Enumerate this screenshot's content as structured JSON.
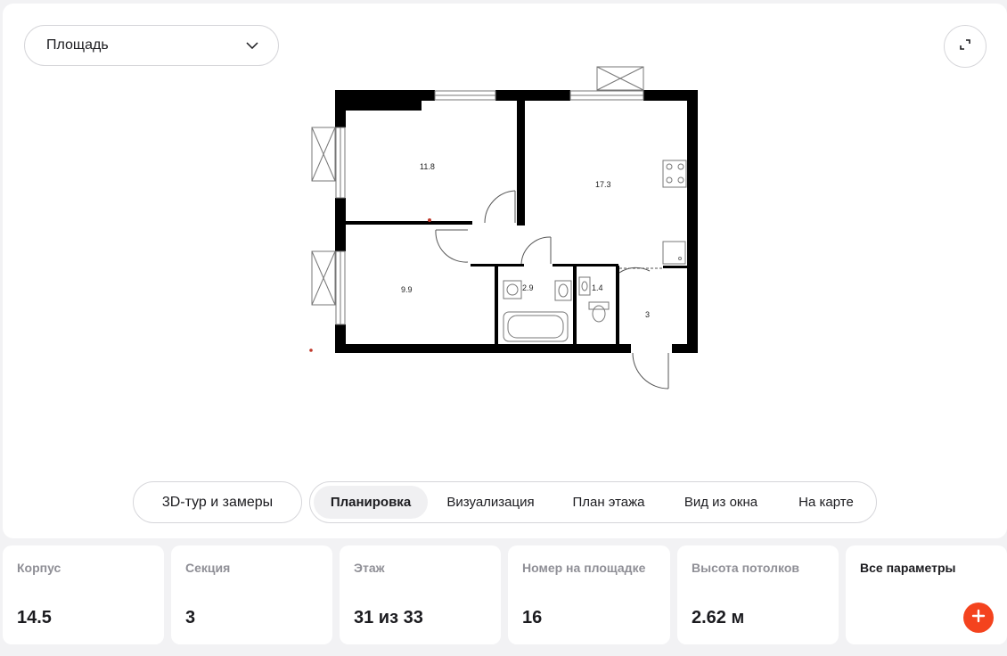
{
  "area_select": {
    "label": "Площадь"
  },
  "floorplan": {
    "rooms": [
      {
        "id": "bedroom-1",
        "area": "11.8"
      },
      {
        "id": "kitchen-living",
        "area": "17.3"
      },
      {
        "id": "bedroom-2",
        "area": "9.9"
      },
      {
        "id": "bathroom",
        "area": "2.9"
      },
      {
        "id": "toilet",
        "area": "1.4"
      },
      {
        "id": "hallway",
        "area": "3"
      }
    ]
  },
  "tour_button": {
    "label": "3D-тур и замеры"
  },
  "view_tabs": [
    {
      "label": "Планировка",
      "active": true
    },
    {
      "label": "Визуализация",
      "active": false
    },
    {
      "label": "План этажа",
      "active": false
    },
    {
      "label": "Вид из окна",
      "active": false
    },
    {
      "label": "На карте",
      "active": false
    }
  ],
  "params": [
    {
      "label": "Корпус",
      "value": "14.5"
    },
    {
      "label": "Секция",
      "value": "3"
    },
    {
      "label": "Этаж",
      "value": "31 из 33"
    },
    {
      "label": "Номер на площадке",
      "value": "16"
    },
    {
      "label": "Высота потолков",
      "value": "2.62 м"
    }
  ],
  "all_params": {
    "label": "Все параметры"
  },
  "colors": {
    "accent": "#f4431e",
    "wall": "#000000",
    "red_marker": "#c0392b"
  }
}
